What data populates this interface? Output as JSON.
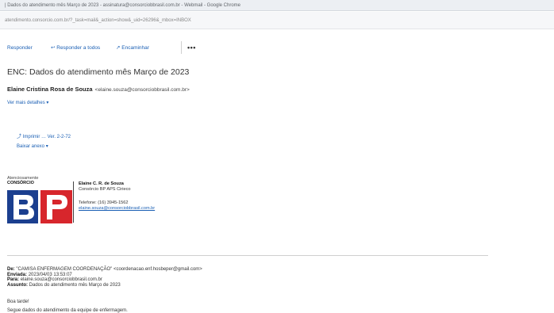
{
  "window": {
    "title": "| Dados do atendimento mês Março de 2023 - assinatura@consorciobbrasil.com.br - Webmail - Google Chrome",
    "url": "atendimento.consorcio.com.br/?_task=mail&_action=show&_uid=26296&_mbox=INBOX"
  },
  "toolbar": {
    "reply": "Responder",
    "reply_all": "↩ Responder a todos",
    "forward": "↗ Encaminhar",
    "more": "•••"
  },
  "message": {
    "subject": "ENC: Dados do atendimento mês Março de 2023",
    "sender_name": "Elaine Cristina Rosa de Souza",
    "sender_email": "<elaine.souza@consorciobbrasil.com.br>",
    "see_more": "Ver mais detalhes ▾",
    "trail_a": "⤴ Imprimir … Ver. 2-2-72",
    "trail_b": "Baixar anexo ▾"
  },
  "signature": {
    "small_line1": "Atenciosamente",
    "small_line2": "CONSÓRCIO",
    "name": "Elaine C. R. de Souza",
    "company": "Consórcio BP APS Cirieco",
    "phone": "Telefone: (16) 3945-1562",
    "email": "elaine.souza@consorciobbrasil.com.br",
    "logo_letters": "BP"
  },
  "forwarded": {
    "from_label": "De:",
    "from_value": "\"CAMISA ENFERMAGEM COORDENAÇÃO\" <coordenacao.enf.hosbeper@gmail.com>",
    "sent_label": "Enviada:",
    "sent_value": "2023/04/03 13:53:07",
    "to_label": "Para:",
    "to_value": "elaine.souza@consorciobbrasil.com.br",
    "subject_label": "Assunto:",
    "subject_value": "Dados do atendimento mês Março de 2023"
  },
  "body": {
    "greeting": "Boa tarde!",
    "line1": "Segue dados do atendimento da equipe de enfermagem."
  },
  "colors": {
    "logo_blue": "#1b3f8f",
    "logo_red": "#d7262c",
    "link": "#1a5fb4"
  }
}
